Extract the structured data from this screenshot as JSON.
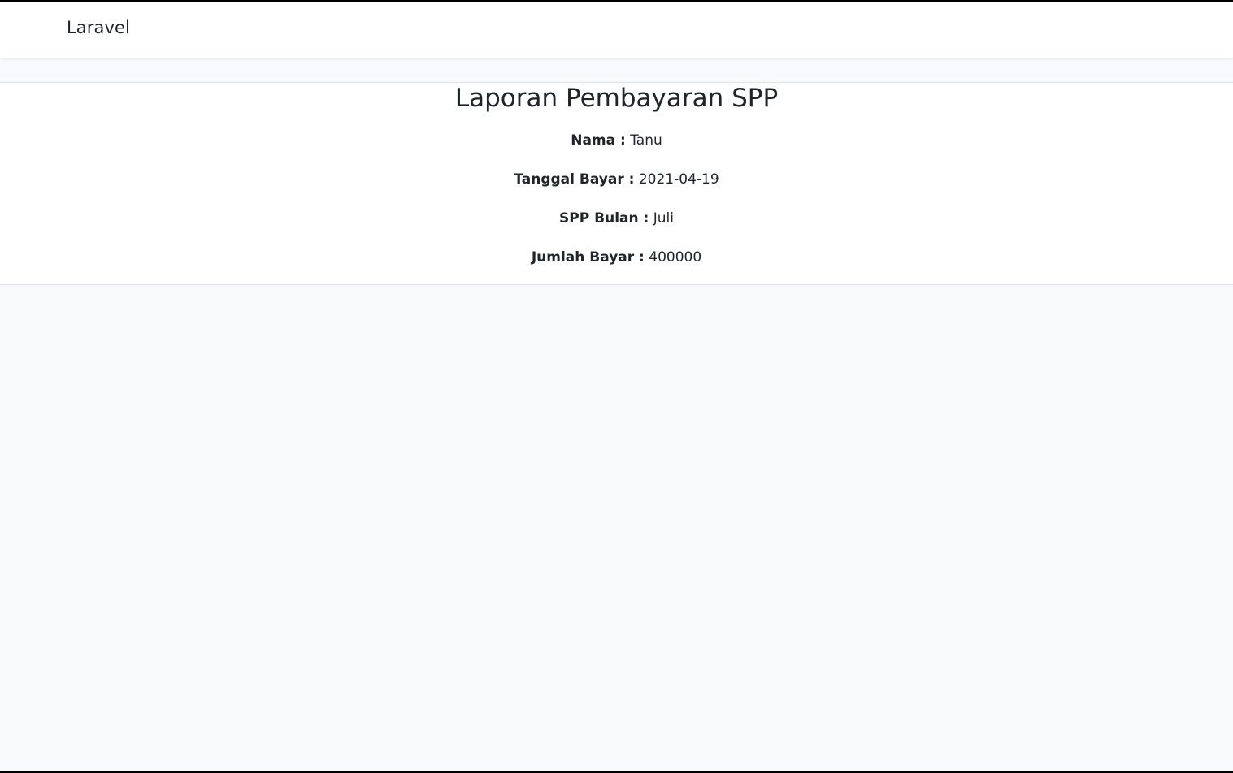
{
  "navbar": {
    "brand": "Laravel"
  },
  "report": {
    "title": "Laporan Pembayaran SPP",
    "fields": [
      {
        "label": "Nama :",
        "value": "Tanu"
      },
      {
        "label": "Tanggal Bayar :",
        "value": "2021-04-19"
      },
      {
        "label": "SPP Bulan :",
        "value": "Juli"
      },
      {
        "label": "Jumlah Bayar :",
        "value": "400000"
      }
    ]
  }
}
